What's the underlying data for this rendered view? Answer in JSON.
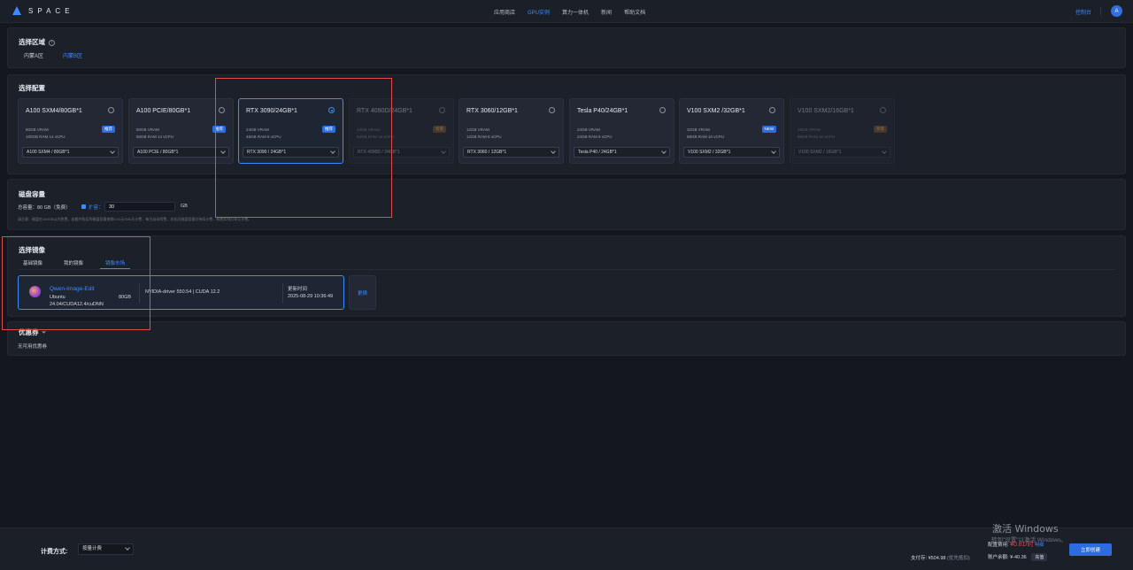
{
  "brand": {
    "name": "SPACE"
  },
  "nav": {
    "items": [
      {
        "label": "应用商店",
        "active": false
      },
      {
        "label": "GPU实例",
        "active": true
      },
      {
        "label": "算力一体机",
        "active": false
      },
      {
        "label": "新闻",
        "active": false
      },
      {
        "label": "帮助文档",
        "active": false
      }
    ],
    "console": "控制台",
    "avatar": "A"
  },
  "region": {
    "title": "选择区域",
    "tabs": [
      {
        "label": "内蒙A区",
        "active": false
      },
      {
        "label": "内蒙B区",
        "active": true
      }
    ]
  },
  "config": {
    "title": "选择配置",
    "cards": [
      {
        "name": "A100 SXM4/80GB*1",
        "vram": "80GB VRAM",
        "ram": "100GB RAM 14 vCPU",
        "badge": "推荐",
        "badge_type": "rec",
        "option": "A100 SXM4 / 80GB*1",
        "selected": false,
        "disabled": false
      },
      {
        "name": "A100 PCIE/80GB*1",
        "vram": "80GB VRAM",
        "ram": "50GB RAM 14 vCPU",
        "badge": "推荐",
        "badge_type": "rec",
        "option": "A100 PCIE / 80GB*1",
        "selected": false,
        "disabled": false
      },
      {
        "name": "RTX 3090/24GB*1",
        "vram": "24GB VRAM",
        "ram": "48GB RAM 8 vCPU",
        "badge": "推荐",
        "badge_type": "rec",
        "option": "RTX 3090 / 24GB*1",
        "selected": true,
        "disabled": false
      },
      {
        "name": "RTX 4090D/24GB*1",
        "vram": "24GB VRAM",
        "ram": "64GB RAM 16 vCPU",
        "badge": "售罄",
        "badge_type": "free",
        "option": "RTX 4090D / 24GB*1",
        "selected": false,
        "disabled": true
      },
      {
        "name": "RTX 3060/12GB*1",
        "vram": "12GB VRAM",
        "ram": "12GB RAM 6 vCPU",
        "badge": "",
        "badge_type": "",
        "option": "RTX 3060 / 12GB*1",
        "selected": false,
        "disabled": false
      },
      {
        "name": "Tesla P40/24GB*1",
        "vram": "24GB VRAM",
        "ram": "24GB RAM 8 vCPU",
        "badge": "",
        "badge_type": "",
        "option": "Tesla P40 / 24GB*1",
        "selected": false,
        "disabled": false
      },
      {
        "name": "V100 SXM2 /32GB*1",
        "vram": "32GB VRAM",
        "ram": "88GB RAM 10 vCPU",
        "badge": "NEW",
        "badge_type": "new",
        "option": "V100 SXM2 / 32GB*1",
        "selected": false,
        "disabled": false
      },
      {
        "name": "V100 SXM2/16GB*1",
        "vram": "16GB VRAM",
        "ram": "88GB RAM 10 vCPU",
        "badge": "售罄",
        "badge_type": "free",
        "option": "V100 SXM2 / 16GB*1",
        "selected": false,
        "disabled": true
      }
    ]
  },
  "disk": {
    "title": "磁盘容量",
    "total": "总容量：80 GB（免费）",
    "expand_label": "扩容：",
    "value": "30",
    "unit": "GB",
    "note": "请注意：磁盘在100GB以内免费，若额外购买的磁盘容量按照0.01元/GB/天计费，每日自动续费，关机后磁盘容量仍持续计费，释放实例后停止计费。"
  },
  "image": {
    "title": "选择镜像",
    "tabs": [
      {
        "label": "基础镜像",
        "active": false
      },
      {
        "label": "我的镜像",
        "active": false
      },
      {
        "label": "镜像市场",
        "active": true
      }
    ],
    "name": "Qwen-Image-Edit",
    "os": "Ubuntu",
    "version": "24.04/CUDA12.4/cuDNN",
    "size": "80GB",
    "driver": "NVIDIA-driver 550.54 | CUDA 12.2",
    "update_label": "更新时间",
    "update_time": "2025-08-29 10:36:49",
    "replace": "更换"
  },
  "coupon": {
    "title": "优惠券",
    "note": "无可用优惠券"
  },
  "footer": {
    "billing_label": "计费方式:",
    "billing_value": "按量计费",
    "watermark_line1": "激活 Windows",
    "watermark_line2": "转到\"设置\"以激活 Windows。",
    "config_fee_label": "配置费用:",
    "config_fee_value": "¥0.81/时",
    "detail_link": "明细",
    "pay_label": "支付存:",
    "pay_value": "¥504.98",
    "pay_note": "(优先抵扣)",
    "balance_label": "账户余额:",
    "balance_value": "¥-40.36",
    "recharge": "充值",
    "create_button": "立即创建"
  }
}
